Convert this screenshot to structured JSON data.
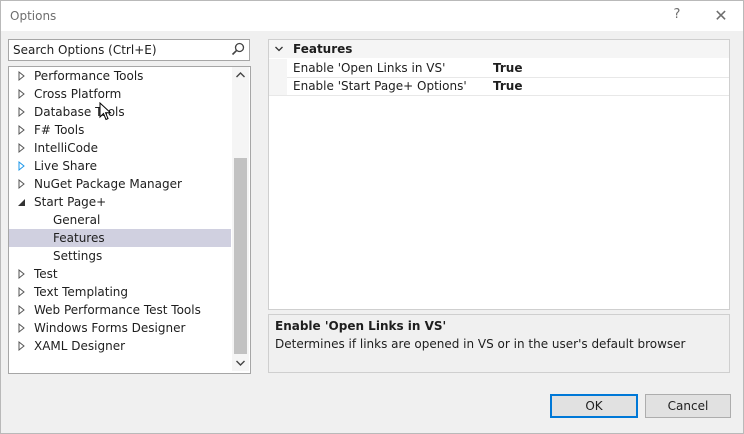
{
  "window": {
    "title": "Options",
    "help_label": "?",
    "close_label": "✕"
  },
  "search": {
    "placeholder": "Search Options (Ctrl+E)"
  },
  "tree": {
    "items": [
      {
        "label": "Performance Tools",
        "expander": "collapsed",
        "indent": 0
      },
      {
        "label": "Cross Platform",
        "expander": "collapsed",
        "indent": 0
      },
      {
        "label": "Database Tools",
        "expander": "collapsed",
        "indent": 0
      },
      {
        "label": "F# Tools",
        "expander": "collapsed",
        "indent": 0
      },
      {
        "label": "IntelliCode",
        "expander": "collapsed",
        "indent": 0
      },
      {
        "label": "Live Share",
        "expander": "collapsed-blue",
        "indent": 0
      },
      {
        "label": "NuGet Package Manager",
        "expander": "collapsed",
        "indent": 0
      },
      {
        "label": "Start Page+",
        "expander": "expanded",
        "indent": 0
      },
      {
        "label": "General",
        "expander": "none",
        "indent": 1
      },
      {
        "label": "Features",
        "expander": "none",
        "indent": 1,
        "selected": true
      },
      {
        "label": "Settings",
        "expander": "none",
        "indent": 1
      },
      {
        "label": "Test",
        "expander": "collapsed",
        "indent": 0
      },
      {
        "label": "Text Templating",
        "expander": "collapsed",
        "indent": 0
      },
      {
        "label": "Web Performance Test Tools",
        "expander": "collapsed",
        "indent": 0
      },
      {
        "label": "Windows Forms Designer",
        "expander": "collapsed",
        "indent": 0
      },
      {
        "label": "XAML Designer",
        "expander": "collapsed",
        "indent": 0
      }
    ]
  },
  "grid": {
    "category": "Features",
    "properties": [
      {
        "name": "Enable 'Open Links in VS'",
        "value": "True"
      },
      {
        "name": "Enable 'Start Page+ Options'",
        "value": "True"
      }
    ]
  },
  "description": {
    "title": "Enable 'Open Links in VS'",
    "text": "Determines if links are opened in VS or in the user's default browser"
  },
  "buttons": {
    "ok": "OK",
    "cancel": "Cancel"
  },
  "colors": {
    "selection": "#d0d0e0",
    "accent": "#0078d7"
  }
}
